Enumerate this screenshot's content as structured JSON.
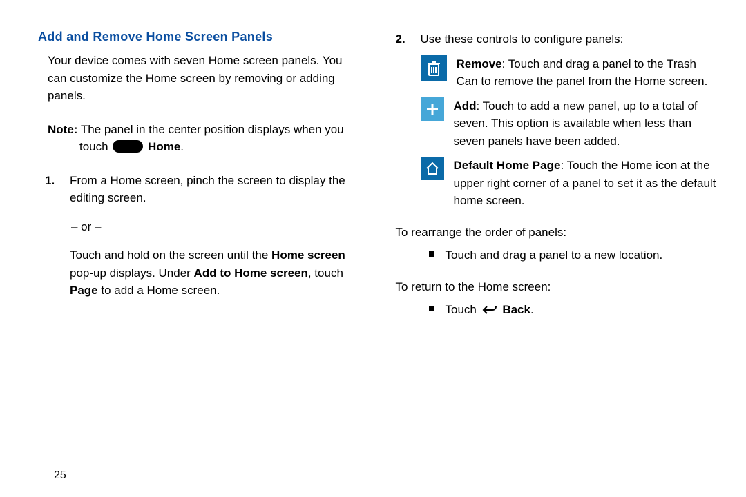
{
  "left": {
    "heading": "Add and Remove Home Screen Panels",
    "intro": "Your device comes with seven Home screen panels. You can customize the Home screen by removing or adding panels.",
    "note_label": "Note:",
    "note_text1": " The panel in the center position displays when you",
    "note_text2a": "touch ",
    "note_text2b": " Home",
    "note_text2c": ".",
    "step1_num": "1.",
    "step1a": "From a Home screen, pinch the screen to display the editing screen.",
    "step1_or": "– or –",
    "step1b_a": "Touch and hold on the screen until the ",
    "step1b_b": "Home screen",
    "step1b_c": " pop-up displays. Under ",
    "step1b_d": "Add to Home screen",
    "step1b_e": ", touch ",
    "step1b_f": "Page",
    "step1b_g": " to add a Home screen."
  },
  "right": {
    "step2_num": "2.",
    "step2_intro": "Use these controls to configure panels:",
    "remove_bold": "Remove",
    "remove_text": ": Touch and drag a panel to the Trash Can to remove the panel from the Home screen.",
    "add_bold": "Add",
    "add_text": ": Touch to add a new panel, up to a total of seven. This option is available when less than seven panels have been added.",
    "home_bold": "Default Home Page",
    "home_text": ": Touch the Home icon at the upper right corner of a panel to set it as the default home screen.",
    "rearrange_heading": "To rearrange the order of panels:",
    "rearrange_bullet": "Touch and drag a panel to a new location.",
    "return_heading": "To return to the Home screen:",
    "back_prefix": "Touch ",
    "back_bold": " Back",
    "back_suffix": "."
  },
  "page_number": "25"
}
